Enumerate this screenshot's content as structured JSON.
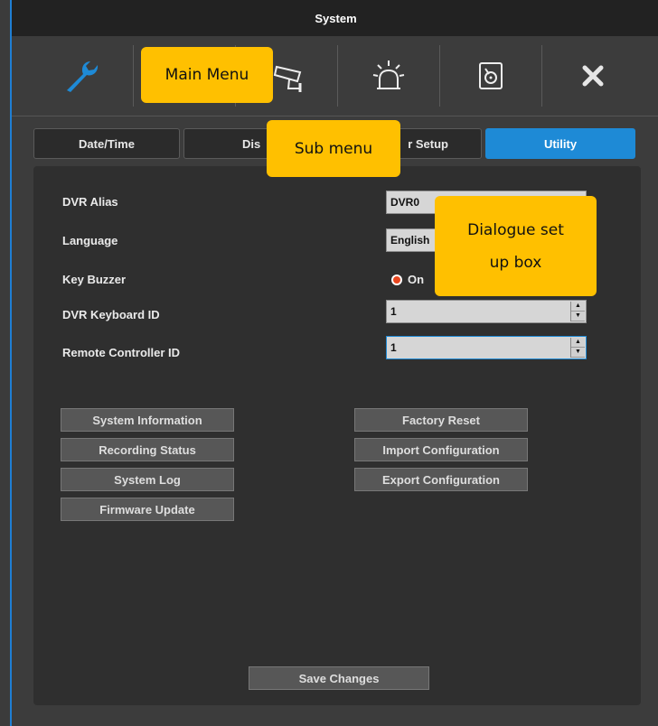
{
  "window": {
    "title": "System"
  },
  "main_menu": {
    "items": [
      {
        "icon": "wrench-icon"
      },
      {
        "icon": "monitor-icon"
      },
      {
        "icon": "camera-icon"
      },
      {
        "icon": "alarm-icon"
      },
      {
        "icon": "disk-icon"
      },
      {
        "icon": "close-icon"
      }
    ]
  },
  "callouts": {
    "main_menu": "Main Menu",
    "sub_menu": "Sub menu",
    "dialogue_line1": "Dialogue set",
    "dialogue_line2": "up box"
  },
  "tabs": [
    {
      "label": "Date/Time"
    },
    {
      "label": "Dis"
    },
    {
      "label": "r Setup"
    },
    {
      "label": "Utility",
      "active": true
    }
  ],
  "form": {
    "dvr_alias_label": "DVR Alias",
    "dvr_alias_value": "DVR0",
    "language_label": "Language",
    "language_value": "English",
    "key_buzzer_label": "Key Buzzer",
    "key_buzzer_option": "On",
    "keyboard_id_label": "DVR Keyboard ID",
    "keyboard_id_value": "1",
    "remote_id_label": "Remote Controller ID",
    "remote_id_value": "1"
  },
  "buttons": {
    "system_information": "System Information",
    "recording_status": "Recording Status",
    "system_log": "System Log",
    "firmware_update": "Firmware Update",
    "factory_reset": "Factory Reset",
    "import_configuration": "Import Configuration",
    "export_configuration": "Export Configuration",
    "save_changes": "Save Changes"
  },
  "colors": {
    "accent": "#1e8ad6",
    "callout": "#ffc000",
    "radio_selected": "#e8461f"
  }
}
